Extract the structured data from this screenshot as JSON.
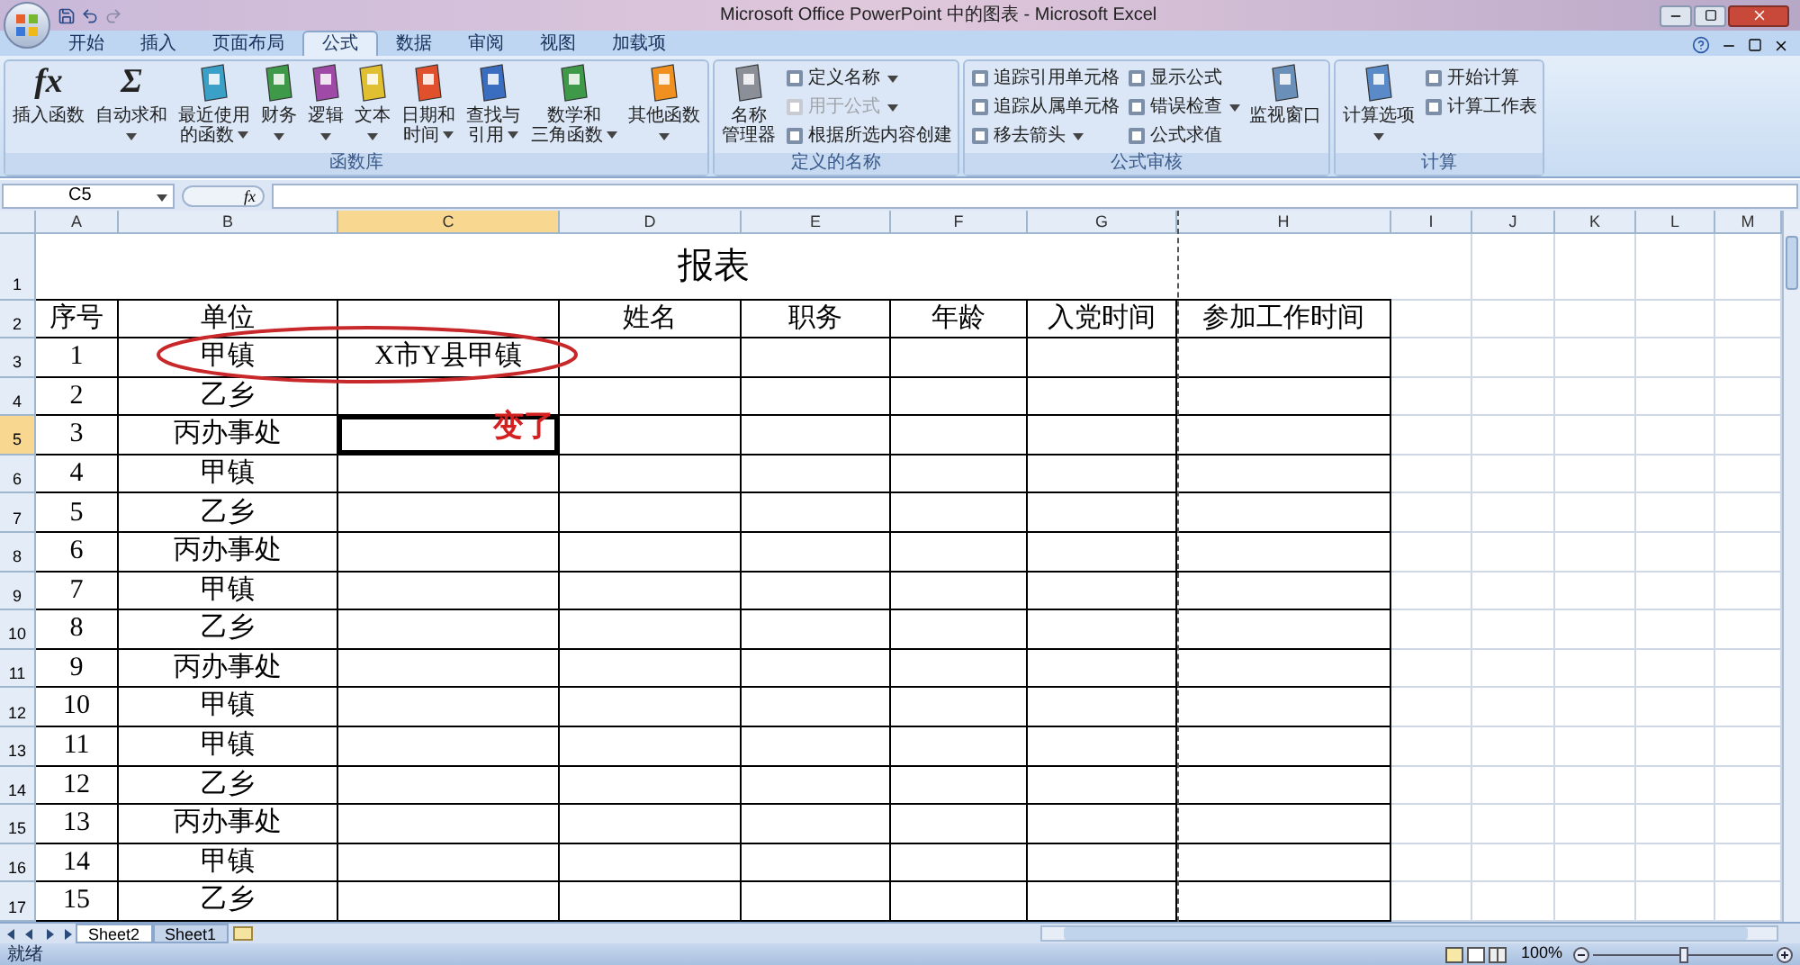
{
  "window": {
    "title": "Microsoft Office PowerPoint 中的图表 - Microsoft Excel"
  },
  "tabs": [
    {
      "label": "开始",
      "selected": false
    },
    {
      "label": "插入",
      "selected": false
    },
    {
      "label": "页面布局",
      "selected": false
    },
    {
      "label": "公式",
      "selected": true
    },
    {
      "label": "数据",
      "selected": false
    },
    {
      "label": "审阅",
      "selected": false
    },
    {
      "label": "视图",
      "selected": false
    },
    {
      "label": "加载项",
      "selected": false
    }
  ],
  "ribbon": {
    "groups": [
      {
        "title": "函数库",
        "items": [
          {
            "kind": "large",
            "lines": [
              "插入函数"
            ],
            "glyph": "fx",
            "dropdown": false
          },
          {
            "kind": "large",
            "lines": [
              "自动求和"
            ],
            "glyph": "Σ",
            "dropdown": true
          },
          {
            "kind": "large",
            "lines": [
              "最近使用",
              "的函数"
            ],
            "color": "#3aa0c8",
            "dropdown": true
          },
          {
            "kind": "large",
            "lines": [
              "财务"
            ],
            "color": "#3e9a48",
            "dropdown": true
          },
          {
            "kind": "large",
            "lines": [
              "逻辑"
            ],
            "color": "#a04aa8",
            "dropdown": true
          },
          {
            "kind": "large",
            "lines": [
              "文本"
            ],
            "color": "#e0c030",
            "dropdown": true
          },
          {
            "kind": "large",
            "lines": [
              "日期和",
              "时间"
            ],
            "color": "#e0502c",
            "dropdown": true
          },
          {
            "kind": "large",
            "lines": [
              "查找与",
              "引用"
            ],
            "color": "#3a6cc0",
            "dropdown": true
          },
          {
            "kind": "large",
            "lines": [
              "数学和",
              "三角函数"
            ],
            "color": "#3e9a48",
            "dropdown": true
          },
          {
            "kind": "large",
            "lines": [
              "其他函数"
            ],
            "color": "#f09020",
            "dropdown": true
          }
        ]
      },
      {
        "title": "定义的名称",
        "items": [
          {
            "kind": "large",
            "lines": [
              "名称",
              "管理器"
            ],
            "color": "#8a8f98",
            "dropdown": false
          },
          {
            "kind": "stack",
            "items": [
              {
                "label": "定义名称",
                "dropdown": true,
                "disabled": false
              },
              {
                "label": "用于公式",
                "dropdown": true,
                "disabled": true
              },
              {
                "label": "根据所选内容创建",
                "dropdown": false,
                "disabled": false
              }
            ]
          }
        ]
      },
      {
        "title": "公式审核",
        "items": [
          {
            "kind": "stack",
            "items": [
              {
                "label": "追踪引用单元格",
                "dropdown": false,
                "disabled": false
              },
              {
                "label": "追踪从属单元格",
                "dropdown": false,
                "disabled": false
              },
              {
                "label": "移去箭头",
                "dropdown": true,
                "disabled": false
              }
            ]
          },
          {
            "kind": "stack",
            "items": [
              {
                "label": "显示公式",
                "dropdown": false,
                "disabled": false
              },
              {
                "label": "错误检查",
                "dropdown": true,
                "disabled": false
              },
              {
                "label": "公式求值",
                "dropdown": false,
                "disabled": false
              }
            ]
          },
          {
            "kind": "large",
            "lines": [
              "监视窗口"
            ],
            "color": "#6a8fb8",
            "dropdown": false
          }
        ]
      },
      {
        "title": "计算",
        "items": [
          {
            "kind": "large",
            "lines": [
              "计算选项"
            ],
            "color": "#5a8ac8",
            "dropdown": true
          },
          {
            "kind": "stack",
            "items": [
              {
                "label": "开始计算",
                "dropdown": false,
                "disabled": false
              },
              {
                "label": "计算工作表",
                "dropdown": false,
                "disabled": false
              }
            ]
          }
        ]
      }
    ]
  },
  "formula_bar": {
    "name_box": "C5",
    "fx": "fx"
  },
  "columns": [
    {
      "label": "A",
      "selected": false
    },
    {
      "label": "B",
      "selected": false
    },
    {
      "label": "C",
      "selected": true
    },
    {
      "label": "D",
      "selected": false
    },
    {
      "label": "E",
      "selected": false
    },
    {
      "label": "F",
      "selected": false
    },
    {
      "label": "G",
      "selected": false
    },
    {
      "label": "H",
      "selected": false
    },
    {
      "label": "I",
      "selected": false
    },
    {
      "label": "J",
      "selected": false
    },
    {
      "label": "K",
      "selected": false
    },
    {
      "label": "L",
      "selected": false
    },
    {
      "label": "M",
      "selected": false
    }
  ],
  "sheet_title": {
    "row": "1",
    "text": "报表"
  },
  "rows": [
    {
      "row": "2",
      "selected": false,
      "cells": [
        "序号",
        "单位",
        "",
        "姓名",
        "职务",
        "年龄",
        "入党时间",
        "参加工作时间"
      ]
    },
    {
      "row": "3",
      "selected": false,
      "cells": [
        "1",
        "甲镇",
        "X市Y县甲镇",
        "",
        "",
        "",
        "",
        ""
      ]
    },
    {
      "row": "4",
      "selected": false,
      "cells": [
        "2",
        "乙乡",
        "",
        "",
        "",
        "",
        "",
        ""
      ]
    },
    {
      "row": "5",
      "selected": true,
      "cells": [
        "3",
        "丙办事处",
        "",
        "",
        "",
        "",
        "",
        ""
      ]
    },
    {
      "row": "6",
      "selected": false,
      "cells": [
        "4",
        "甲镇",
        "",
        "",
        "",
        "",
        "",
        ""
      ]
    },
    {
      "row": "7",
      "selected": false,
      "cells": [
        "5",
        "乙乡",
        "",
        "",
        "",
        "",
        "",
        ""
      ]
    },
    {
      "row": "8",
      "selected": false,
      "cells": [
        "6",
        "丙办事处",
        "",
        "",
        "",
        "",
        "",
        ""
      ]
    },
    {
      "row": "9",
      "selected": false,
      "cells": [
        "7",
        "甲镇",
        "",
        "",
        "",
        "",
        "",
        ""
      ]
    },
    {
      "row": "10",
      "selected": false,
      "cells": [
        "8",
        "乙乡",
        "",
        "",
        "",
        "",
        "",
        ""
      ]
    },
    {
      "row": "11",
      "selected": false,
      "cells": [
        "9",
        "丙办事处",
        "",
        "",
        "",
        "",
        "",
        ""
      ]
    },
    {
      "row": "12",
      "selected": false,
      "cells": [
        "10",
        "甲镇",
        "",
        "",
        "",
        "",
        "",
        ""
      ]
    },
    {
      "row": "13",
      "selected": false,
      "cells": [
        "11",
        "甲镇",
        "",
        "",
        "",
        "",
        "",
        ""
      ]
    },
    {
      "row": "14",
      "selected": false,
      "cells": [
        "12",
        "乙乡",
        "",
        "",
        "",
        "",
        "",
        ""
      ]
    },
    {
      "row": "15",
      "selected": false,
      "cells": [
        "13",
        "丙办事处",
        "",
        "",
        "",
        "",
        "",
        ""
      ]
    },
    {
      "row": "16",
      "selected": false,
      "cells": [
        "14",
        "甲镇",
        "",
        "",
        "",
        "",
        "",
        ""
      ]
    },
    {
      "row": "17",
      "selected": false,
      "cells": [
        "15",
        "乙乡",
        "",
        "",
        "",
        "",
        "",
        ""
      ]
    }
  ],
  "annotation": {
    "note": "变了"
  },
  "sheet_tabs": [
    {
      "label": "Sheet2",
      "selected": true
    },
    {
      "label": "Sheet1",
      "selected": false
    }
  ],
  "status_bar": {
    "status": "就绪",
    "zoom": "100%",
    "zoom_level": {
      "level": 0.5
    }
  }
}
